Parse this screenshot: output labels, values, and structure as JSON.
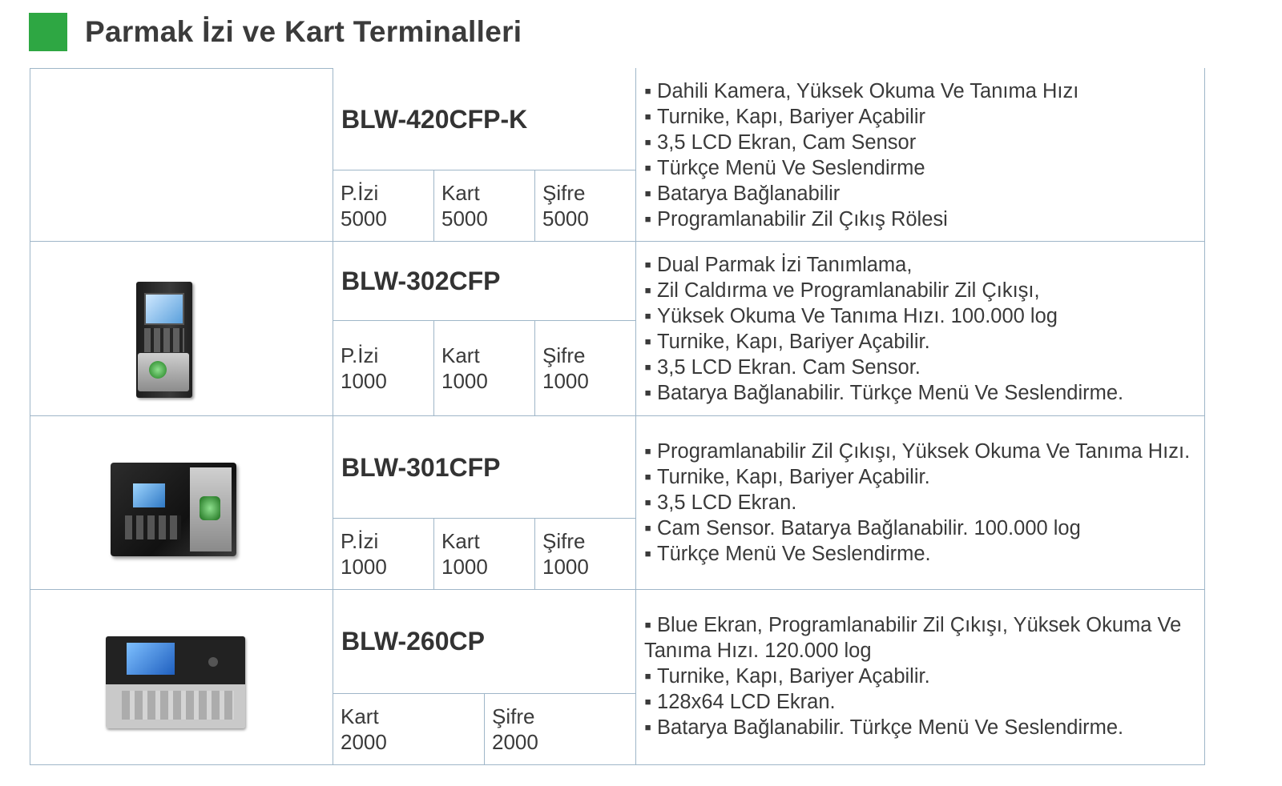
{
  "page_title": "Parmak İzi ve Kart Terminalleri",
  "accent_color": "#2ea743",
  "products": [
    {
      "model": "BLW-420CFP-K",
      "specs": [
        {
          "label": "P.İzi",
          "value": "5000"
        },
        {
          "label": "Kart",
          "value": "5000"
        },
        {
          "label": "Şifre",
          "value": "5000"
        }
      ],
      "features": [
        "Dahili Kamera,  Yüksek Okuma Ve Tanıma Hızı",
        "Turnike, Kapı, Bariyer Açabilir",
        "3,5 LCD Ekran, Cam Sensor",
        "Türkçe Menü Ve Seslendirme",
        "Batarya Bağlanabilir",
        "Programlanabilir Zil Çıkış Rölesi"
      ]
    },
    {
      "model": "BLW-302CFP",
      "specs": [
        {
          "label": "P.İzi",
          "value": "1000"
        },
        {
          "label": "Kart",
          "value": "1000"
        },
        {
          "label": "Şifre",
          "value": "1000"
        }
      ],
      "features": [
        "Dual Parmak İzi Tanımlama,",
        "Zil Caldırma ve Programlanabilir Zil Çıkışı,",
        "Yüksek Okuma Ve Tanıma Hızı. 100.000 log",
        "Turnike, Kapı, Bariyer Açabilir.",
        "3,5 LCD Ekran. Cam Sensor.",
        "Batarya Bağlanabilir. Türkçe Menü Ve Seslendirme."
      ]
    },
    {
      "model": "BLW-301CFP",
      "specs": [
        {
          "label": "P.İzi",
          "value": "1000"
        },
        {
          "label": "Kart",
          "value": "1000"
        },
        {
          "label": "Şifre",
          "value": "1000"
        }
      ],
      "features": [
        "Programlanabilir Zil Çıkışı, Yüksek Okuma Ve Tanıma Hızı.",
        "Turnike, Kapı, Bariyer Açabilir.",
        "3,5 LCD Ekran.",
        "Cam Sensor. Batarya Bağlanabilir. 100.000 log",
        "Türkçe Menü Ve Seslendirme."
      ]
    },
    {
      "model": "BLW-260CP",
      "specs": [
        {
          "label": "Kart",
          "value": "2000"
        },
        {
          "label": "Şifre",
          "value": "2000"
        }
      ],
      "features": [
        "Blue Ekran, Programlanabilir Zil Çıkışı, Yüksek Okuma Ve Tanıma Hızı. 120.000 log",
        "Turnike, Kapı, Bariyer Açabilir.",
        "128x64 LCD Ekran.",
        "Batarya Bağlanabilir. Türkçe Menü Ve Seslendirme."
      ]
    }
  ]
}
